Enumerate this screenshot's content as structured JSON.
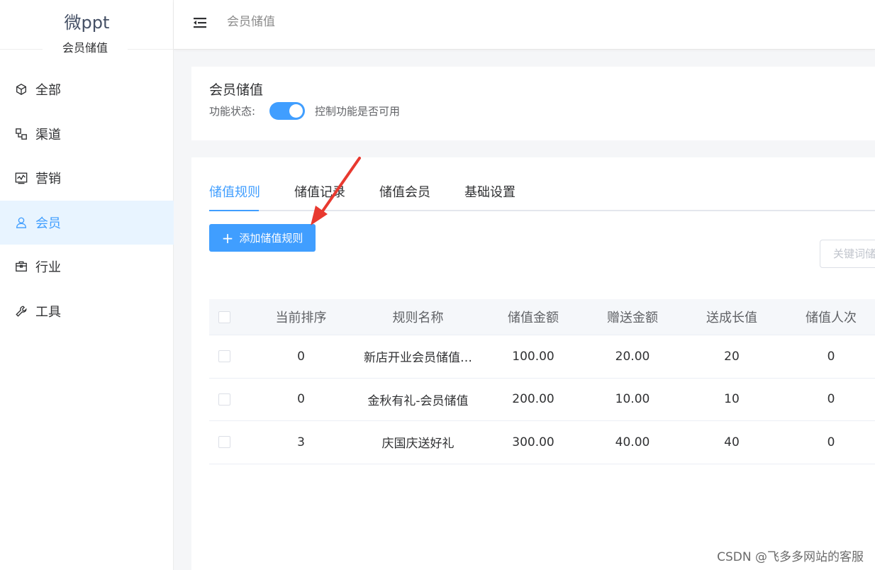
{
  "brand": {
    "name": "微ppt",
    "subtitle": "会员储值"
  },
  "sidebar": {
    "items": [
      {
        "label": "全部",
        "icon": "cube-icon",
        "active": false
      },
      {
        "label": "渠道",
        "icon": "channel-icon",
        "active": false
      },
      {
        "label": "营销",
        "icon": "chart-icon",
        "active": false
      },
      {
        "label": "会员",
        "icon": "user-icon",
        "active": true
      },
      {
        "label": "行业",
        "icon": "briefcase-icon",
        "active": false
      },
      {
        "label": "工具",
        "icon": "wrench-icon",
        "active": false
      }
    ]
  },
  "header": {
    "breadcrumb": "会员储值"
  },
  "feature": {
    "title": "会员储值",
    "status_label": "功能状态:",
    "status_enabled": true,
    "status_desc": "控制功能是否可用"
  },
  "tabs": [
    {
      "label": "储值规则",
      "active": true
    },
    {
      "label": "储值记录",
      "active": false
    },
    {
      "label": "储值会员",
      "active": false
    },
    {
      "label": "基础设置",
      "active": false
    }
  ],
  "actions": {
    "add_label": "添加储值规则"
  },
  "search": {
    "placeholder": "关键词储"
  },
  "table": {
    "columns": [
      "当前排序",
      "规则名称",
      "储值金额",
      "赠送金额",
      "送成长值",
      "储值人次"
    ],
    "rows": [
      {
        "sort": "0",
        "name": "新店开业会员储值…",
        "amount": "100.00",
        "gift": "20.00",
        "growth": "20",
        "count": "0"
      },
      {
        "sort": "0",
        "name": "金秋有礼-会员储值",
        "amount": "200.00",
        "gift": "10.00",
        "growth": "10",
        "count": "0"
      },
      {
        "sort": "3",
        "name": "庆国庆送好礼",
        "amount": "300.00",
        "gift": "40.00",
        "growth": "40",
        "count": "0"
      }
    ]
  },
  "watermark": "CSDN @飞多多网站的客服",
  "colors": {
    "accent": "#409eff",
    "active_bg": "#e8f4ff",
    "arrow": "#e8392f"
  }
}
